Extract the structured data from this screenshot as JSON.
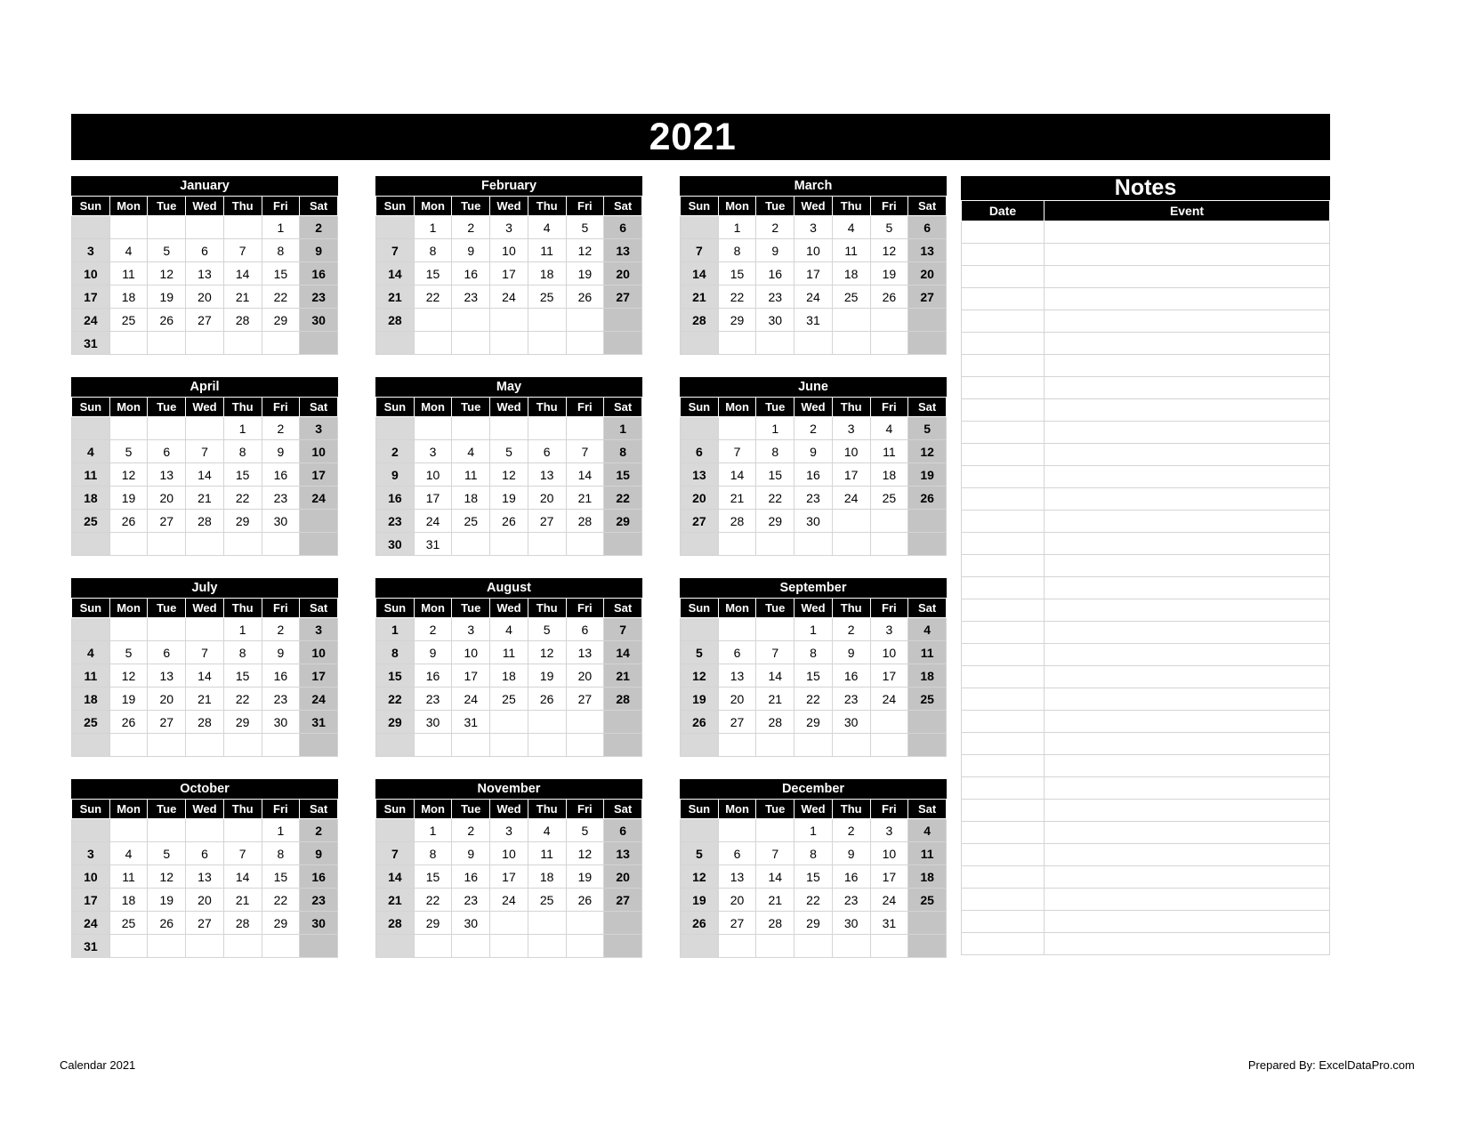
{
  "header": {
    "year": "2021"
  },
  "weekday_labels": [
    "Sun",
    "Mon",
    "Tue",
    "Wed",
    "Thu",
    "Fri",
    "Sat"
  ],
  "colors": {
    "header_bg": "#000000",
    "header_fg": "#ffffff",
    "sunday_bg": "#d9d9d9",
    "saturday_bg": "#c4c4c4",
    "cell_bg": "#ffffff",
    "grid_line": "#d4d4d4"
  },
  "months": [
    {
      "name": "January",
      "weeks": [
        [
          "",
          "",
          "",
          "",
          "",
          "1",
          "2"
        ],
        [
          "3",
          "4",
          "5",
          "6",
          "7",
          "8",
          "9"
        ],
        [
          "10",
          "11",
          "12",
          "13",
          "14",
          "15",
          "16"
        ],
        [
          "17",
          "18",
          "19",
          "20",
          "21",
          "22",
          "23"
        ],
        [
          "24",
          "25",
          "26",
          "27",
          "28",
          "29",
          "30"
        ],
        [
          "31",
          "",
          "",
          "",
          "",
          "",
          ""
        ]
      ]
    },
    {
      "name": "February",
      "weeks": [
        [
          "",
          "1",
          "2",
          "3",
          "4",
          "5",
          "6"
        ],
        [
          "7",
          "8",
          "9",
          "10",
          "11",
          "12",
          "13"
        ],
        [
          "14",
          "15",
          "16",
          "17",
          "18",
          "19",
          "20"
        ],
        [
          "21",
          "22",
          "23",
          "24",
          "25",
          "26",
          "27"
        ],
        [
          "28",
          "",
          "",
          "",
          "",
          "",
          ""
        ],
        [
          "",
          "",
          "",
          "",
          "",
          "",
          ""
        ]
      ]
    },
    {
      "name": "March",
      "weeks": [
        [
          "",
          "1",
          "2",
          "3",
          "4",
          "5",
          "6"
        ],
        [
          "7",
          "8",
          "9",
          "10",
          "11",
          "12",
          "13"
        ],
        [
          "14",
          "15",
          "16",
          "17",
          "18",
          "19",
          "20"
        ],
        [
          "21",
          "22",
          "23",
          "24",
          "25",
          "26",
          "27"
        ],
        [
          "28",
          "29",
          "30",
          "31",
          "",
          "",
          ""
        ],
        [
          "",
          "",
          "",
          "",
          "",
          "",
          ""
        ]
      ]
    },
    {
      "name": "April",
      "weeks": [
        [
          "",
          "",
          "",
          "",
          "1",
          "2",
          "3"
        ],
        [
          "4",
          "5",
          "6",
          "7",
          "8",
          "9",
          "10"
        ],
        [
          "11",
          "12",
          "13",
          "14",
          "15",
          "16",
          "17"
        ],
        [
          "18",
          "19",
          "20",
          "21",
          "22",
          "23",
          "24"
        ],
        [
          "25",
          "26",
          "27",
          "28",
          "29",
          "30",
          ""
        ],
        [
          "",
          "",
          "",
          "",
          "",
          "",
          ""
        ]
      ]
    },
    {
      "name": "May",
      "weeks": [
        [
          "",
          "",
          "",
          "",
          "",
          "",
          "1"
        ],
        [
          "2",
          "3",
          "4",
          "5",
          "6",
          "7",
          "8"
        ],
        [
          "9",
          "10",
          "11",
          "12",
          "13",
          "14",
          "15"
        ],
        [
          "16",
          "17",
          "18",
          "19",
          "20",
          "21",
          "22"
        ],
        [
          "23",
          "24",
          "25",
          "26",
          "27",
          "28",
          "29"
        ],
        [
          "30",
          "31",
          "",
          "",
          "",
          "",
          ""
        ]
      ]
    },
    {
      "name": "June",
      "weeks": [
        [
          "",
          "",
          "1",
          "2",
          "3",
          "4",
          "5"
        ],
        [
          "6",
          "7",
          "8",
          "9",
          "10",
          "11",
          "12"
        ],
        [
          "13",
          "14",
          "15",
          "16",
          "17",
          "18",
          "19"
        ],
        [
          "20",
          "21",
          "22",
          "23",
          "24",
          "25",
          "26"
        ],
        [
          "27",
          "28",
          "29",
          "30",
          "",
          "",
          ""
        ],
        [
          "",
          "",
          "",
          "",
          "",
          "",
          ""
        ]
      ]
    },
    {
      "name": "July",
      "weeks": [
        [
          "",
          "",
          "",
          "",
          "1",
          "2",
          "3"
        ],
        [
          "4",
          "5",
          "6",
          "7",
          "8",
          "9",
          "10"
        ],
        [
          "11",
          "12",
          "13",
          "14",
          "15",
          "16",
          "17"
        ],
        [
          "18",
          "19",
          "20",
          "21",
          "22",
          "23",
          "24"
        ],
        [
          "25",
          "26",
          "27",
          "28",
          "29",
          "30",
          "31"
        ],
        [
          "",
          "",
          "",
          "",
          "",
          "",
          ""
        ]
      ]
    },
    {
      "name": "August",
      "weeks": [
        [
          "1",
          "2",
          "3",
          "4",
          "5",
          "6",
          "7"
        ],
        [
          "8",
          "9",
          "10",
          "11",
          "12",
          "13",
          "14"
        ],
        [
          "15",
          "16",
          "17",
          "18",
          "19",
          "20",
          "21"
        ],
        [
          "22",
          "23",
          "24",
          "25",
          "26",
          "27",
          "28"
        ],
        [
          "29",
          "30",
          "31",
          "",
          "",
          "",
          ""
        ],
        [
          "",
          "",
          "",
          "",
          "",
          "",
          ""
        ]
      ]
    },
    {
      "name": "September",
      "weeks": [
        [
          "",
          "",
          "",
          "1",
          "2",
          "3",
          "4"
        ],
        [
          "5",
          "6",
          "7",
          "8",
          "9",
          "10",
          "11"
        ],
        [
          "12",
          "13",
          "14",
          "15",
          "16",
          "17",
          "18"
        ],
        [
          "19",
          "20",
          "21",
          "22",
          "23",
          "24",
          "25"
        ],
        [
          "26",
          "27",
          "28",
          "29",
          "30",
          "",
          ""
        ],
        [
          "",
          "",
          "",
          "",
          "",
          "",
          ""
        ]
      ]
    },
    {
      "name": "October",
      "weeks": [
        [
          "",
          "",
          "",
          "",
          "",
          "1",
          "2"
        ],
        [
          "3",
          "4",
          "5",
          "6",
          "7",
          "8",
          "9"
        ],
        [
          "10",
          "11",
          "12",
          "13",
          "14",
          "15",
          "16"
        ],
        [
          "17",
          "18",
          "19",
          "20",
          "21",
          "22",
          "23"
        ],
        [
          "24",
          "25",
          "26",
          "27",
          "28",
          "29",
          "30"
        ],
        [
          "31",
          "",
          "",
          "",
          "",
          "",
          ""
        ]
      ]
    },
    {
      "name": "November",
      "weeks": [
        [
          "",
          "1",
          "2",
          "3",
          "4",
          "5",
          "6"
        ],
        [
          "7",
          "8",
          "9",
          "10",
          "11",
          "12",
          "13"
        ],
        [
          "14",
          "15",
          "16",
          "17",
          "18",
          "19",
          "20"
        ],
        [
          "21",
          "22",
          "23",
          "24",
          "25",
          "26",
          "27"
        ],
        [
          "28",
          "29",
          "30",
          "",
          "",
          "",
          ""
        ],
        [
          "",
          "",
          "",
          "",
          "",
          "",
          ""
        ]
      ]
    },
    {
      "name": "December",
      "weeks": [
        [
          "",
          "",
          "",
          "1",
          "2",
          "3",
          "4"
        ],
        [
          "5",
          "6",
          "7",
          "8",
          "9",
          "10",
          "11"
        ],
        [
          "12",
          "13",
          "14",
          "15",
          "16",
          "17",
          "18"
        ],
        [
          "19",
          "20",
          "21",
          "22",
          "23",
          "24",
          "25"
        ],
        [
          "26",
          "27",
          "28",
          "29",
          "30",
          "31",
          ""
        ],
        [
          "",
          "",
          "",
          "",
          "",
          "",
          ""
        ]
      ]
    }
  ],
  "notes": {
    "title": "Notes",
    "columns": [
      "Date",
      "Event"
    ],
    "row_count": 33,
    "rows": [
      {
        "date": "",
        "event": ""
      },
      {
        "date": "",
        "event": ""
      },
      {
        "date": "",
        "event": ""
      },
      {
        "date": "",
        "event": ""
      },
      {
        "date": "",
        "event": ""
      },
      {
        "date": "",
        "event": ""
      },
      {
        "date": "",
        "event": ""
      },
      {
        "date": "",
        "event": ""
      },
      {
        "date": "",
        "event": ""
      },
      {
        "date": "",
        "event": ""
      },
      {
        "date": "",
        "event": ""
      },
      {
        "date": "",
        "event": ""
      },
      {
        "date": "",
        "event": ""
      },
      {
        "date": "",
        "event": ""
      },
      {
        "date": "",
        "event": ""
      },
      {
        "date": "",
        "event": ""
      },
      {
        "date": "",
        "event": ""
      },
      {
        "date": "",
        "event": ""
      },
      {
        "date": "",
        "event": ""
      },
      {
        "date": "",
        "event": ""
      },
      {
        "date": "",
        "event": ""
      },
      {
        "date": "",
        "event": ""
      },
      {
        "date": "",
        "event": ""
      },
      {
        "date": "",
        "event": ""
      },
      {
        "date": "",
        "event": ""
      },
      {
        "date": "",
        "event": ""
      },
      {
        "date": "",
        "event": ""
      },
      {
        "date": "",
        "event": ""
      },
      {
        "date": "",
        "event": ""
      },
      {
        "date": "",
        "event": ""
      },
      {
        "date": "",
        "event": ""
      },
      {
        "date": "",
        "event": ""
      },
      {
        "date": "",
        "event": ""
      }
    ]
  },
  "footer": {
    "left": "Calendar 2021",
    "right": "Prepared By: ExcelDataPro.com"
  }
}
